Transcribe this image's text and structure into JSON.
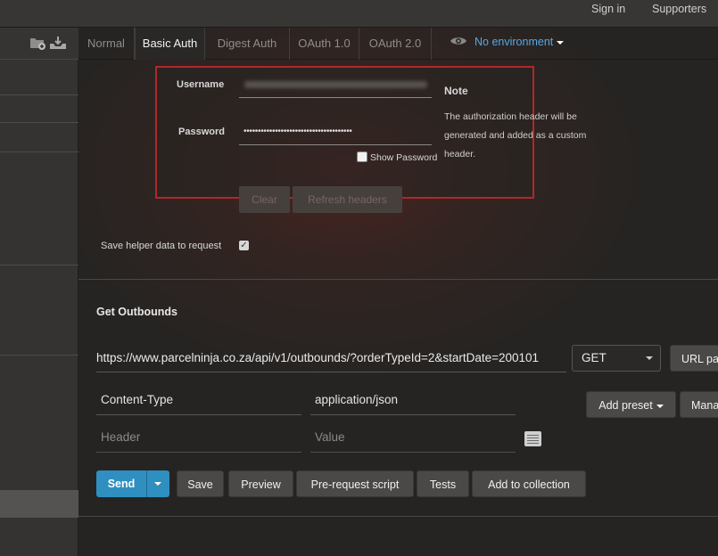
{
  "topbar": {
    "signin": "Sign in",
    "supporters": "Supporters"
  },
  "auth_tabs": [
    {
      "label": "Normal"
    },
    {
      "label": "Basic Auth"
    },
    {
      "label": "Digest Auth"
    },
    {
      "label": "OAuth 1.0"
    },
    {
      "label": "OAuth 2.0"
    }
  ],
  "environment": {
    "label": "No environment",
    "icon": "eye-icon",
    "color": "#55a9e7"
  },
  "auth": {
    "username_label": "Username",
    "password_label": "Password",
    "password_value": "••••••••••••••••••••••••••••••••••••••",
    "show_password_label": "Show Password",
    "note_title": "Note",
    "note_lines": [
      "The authorization header will be",
      "generated and added as a custom",
      "header."
    ],
    "clear_label": "Clear",
    "refresh_label": "Refresh headers",
    "save_helper_label": "Save helper data to request",
    "save_helper_checked": true,
    "highlight_color": "#b0282c"
  },
  "request": {
    "name": "Get Outbounds",
    "url": "https://www.parcelninja.co.za/api/v1/outbounds/?orderTypeId=2&startDate=200101",
    "method": "GET",
    "url_params_label": "URL params",
    "headers": [
      {
        "key": "Content-Type",
        "value": "application/json"
      }
    ],
    "header_placeholder": "Header",
    "value_placeholder": "Value",
    "add_preset_label": "Add preset",
    "manage_label": "Manage presets"
  },
  "actions": {
    "send": "Send",
    "save": "Save",
    "preview": "Preview",
    "pre_request": "Pre-request script",
    "tests": "Tests",
    "add_collection": "Add to collection",
    "send_color": "#2f8fc0"
  }
}
